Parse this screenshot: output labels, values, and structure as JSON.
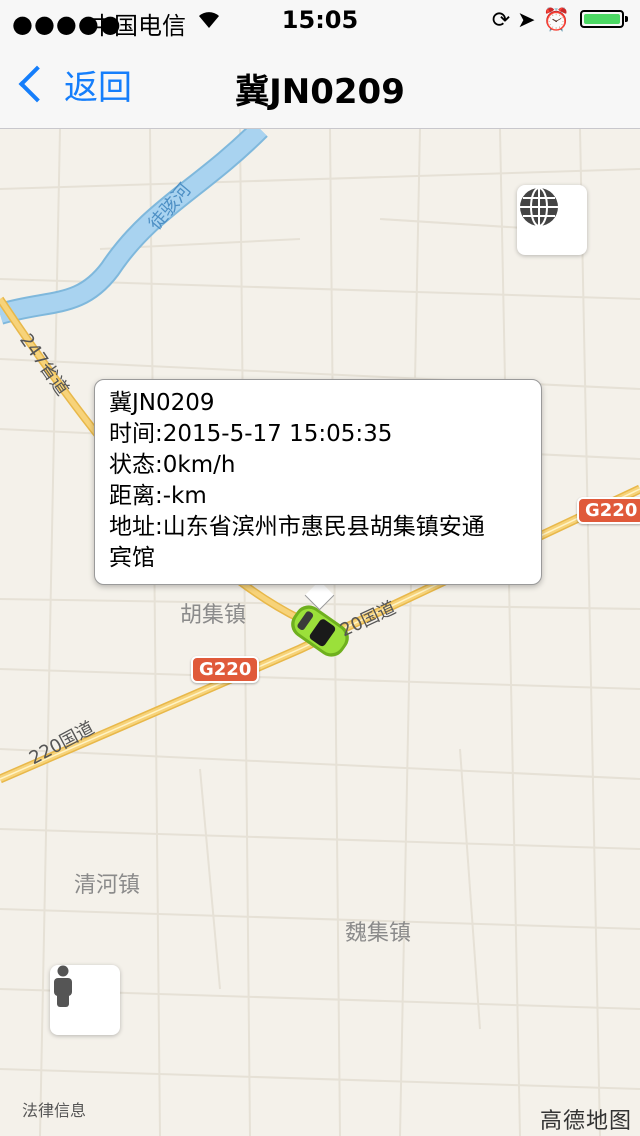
{
  "status": {
    "signal": "●●●●●",
    "carrier": "中国电信",
    "time": "15:05",
    "battery_level": 1.0
  },
  "nav": {
    "back_label": "返回",
    "title": "冀JN0209"
  },
  "map": {
    "river_label": "徒骇河",
    "road_labels": {
      "provincial": "247省道",
      "national_left": "220国道",
      "national_right": "20国道"
    },
    "shields": {
      "left": "G220",
      "right": "G220"
    },
    "places": {
      "huji": "胡集镇",
      "qinghe": "清河镇",
      "weiji": "魏集镇"
    }
  },
  "callout": {
    "plate": "冀JN0209",
    "time": "时间:2015-5-17 15:05:35",
    "status": "状态:0km/h",
    "distance": "距离:-km",
    "address_line1": "地址:山东省滨州市惠民县胡集镇安通",
    "address_line2": "宾馆"
  },
  "footer": {
    "legal": "法律信息",
    "brand": "高德地图"
  },
  "colors": {
    "accent": "#157efb",
    "map_bg": "#f4f1ea",
    "river": "#a9d3f0",
    "road_major": "#f7c75b",
    "shield": "#e05a3a",
    "car": "#8fd32a"
  },
  "icons": [
    "back-chevron-icon",
    "wifi-icon",
    "lock-rotation-icon",
    "location-arrow-icon",
    "alarm-icon",
    "battery-icon",
    "globe-icon",
    "person-icon",
    "car-icon"
  ]
}
